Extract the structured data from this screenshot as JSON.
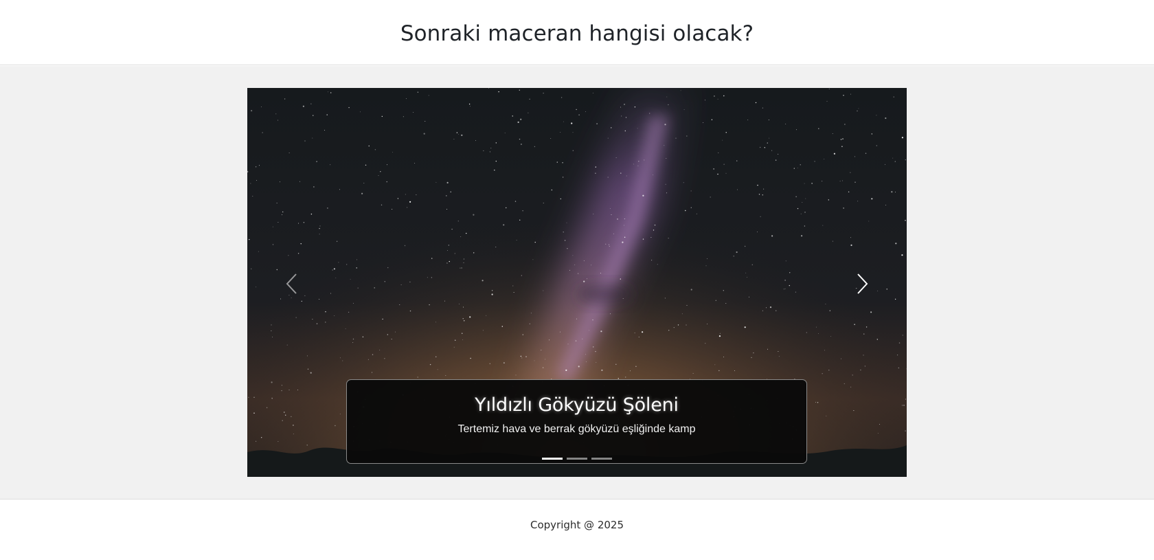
{
  "header": {
    "title": "Sonraki maceran hangisi olacak?"
  },
  "carousel": {
    "active_index": 0,
    "prev_icon": "chevron-left-icon",
    "next_icon": "chevron-right-icon",
    "slide": {
      "title": "Yıldızlı Gökyüzü Şöleni",
      "text": "Tertemiz hava ve berrak gökyüzü eşliğinde kamp"
    },
    "indicator_count": 3
  },
  "footer": {
    "copyright": "Copyright @ 2025"
  },
  "colors": {
    "page_background": "#f1f1f1",
    "caption_background": "#0a0a0a",
    "sky_dark": "#161a1d",
    "milky_way": "#a66cc0",
    "horizon_glow": "#a4784a"
  }
}
